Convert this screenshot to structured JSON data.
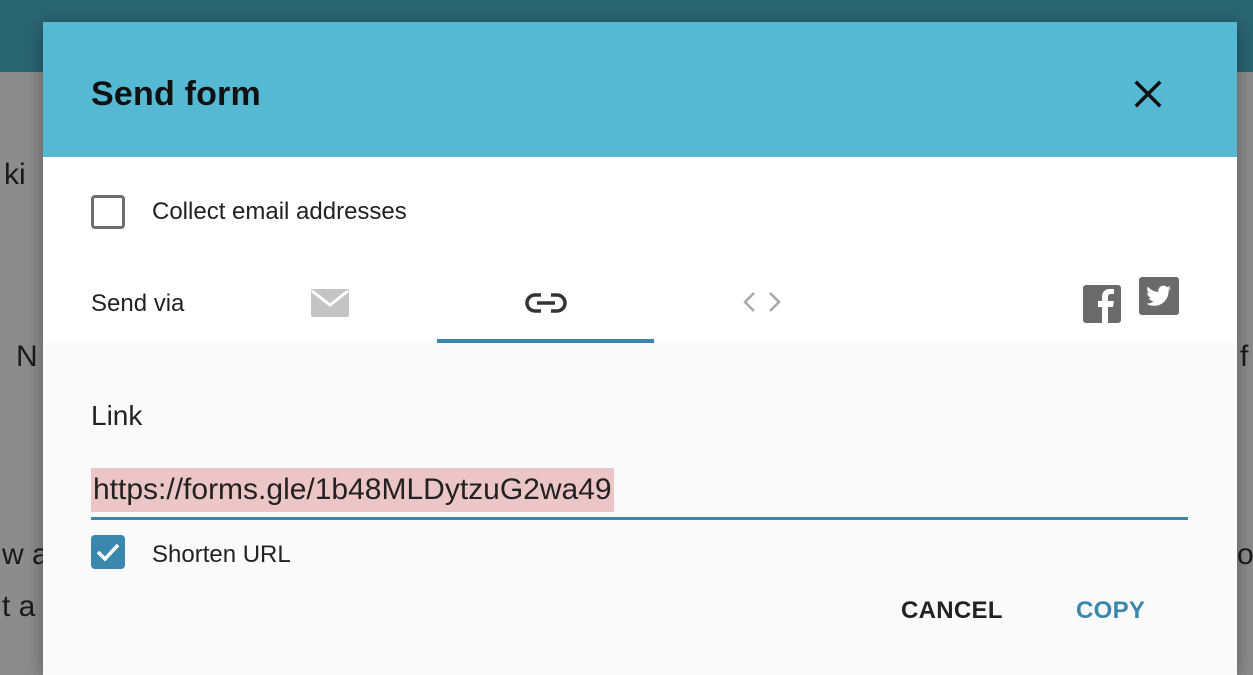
{
  "background": {
    "fragments": [
      "ki",
      "N",
      "f",
      "w a",
      "os",
      "t a"
    ]
  },
  "dialog": {
    "title": "Send form",
    "close_icon": "close-icon",
    "collect_email": {
      "label": "Collect email addresses",
      "checked": false
    },
    "send_via": {
      "label": "Send via",
      "options": [
        {
          "icon": "email-icon"
        },
        {
          "icon": "link-icon",
          "selected": true
        },
        {
          "icon": "embed-code-icon"
        }
      ],
      "social": [
        {
          "icon": "facebook-icon"
        },
        {
          "icon": "twitter-icon"
        }
      ]
    },
    "link_section": {
      "title": "Link",
      "url": "https://forms.gle/1b48MLDytzuG2wa49",
      "shorten": {
        "label": "Shorten URL",
        "checked": true
      }
    },
    "actions": {
      "cancel": "CANCEL",
      "copy": "COPY"
    },
    "colors": {
      "header": "#55b9d3",
      "accent": "#3a87ad",
      "url_highlight": "#ecc6c6"
    }
  }
}
